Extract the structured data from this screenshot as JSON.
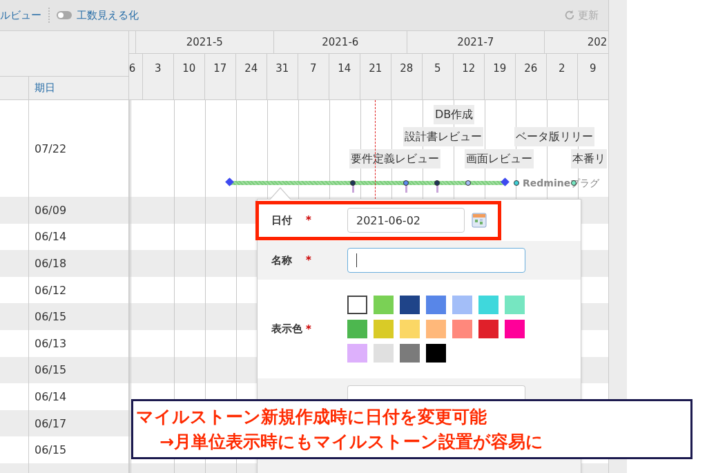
{
  "toolbar": {
    "items": [
      {
        "kind": "link",
        "label": "ルビュー"
      },
      {
        "kind": "toggle",
        "label": "工数見える化",
        "on": false
      }
    ],
    "refresh": {
      "label": "更新",
      "disabled": true
    }
  },
  "due_column": {
    "heading": "期日"
  },
  "timeline": {
    "months": [
      "2021-5",
      "2021-6",
      "2021-7",
      "202"
    ],
    "weeks": [
      "6",
      "3",
      "10",
      "17",
      "24",
      "31",
      "7",
      "14",
      "21",
      "28",
      "5",
      "12",
      "19",
      "26",
      "2",
      "9"
    ]
  },
  "rows": [
    {
      "kind": "project",
      "due": "07/22"
    },
    {
      "kind": "task",
      "due": "06/09"
    },
    {
      "kind": "task",
      "due": "06/14"
    },
    {
      "kind": "task",
      "due": "06/18"
    },
    {
      "kind": "task",
      "due": "06/12"
    },
    {
      "kind": "task",
      "due": "06/15"
    },
    {
      "kind": "task",
      "due": "06/13"
    },
    {
      "kind": "task",
      "due": "06/15"
    },
    {
      "kind": "task",
      "due": "06/14"
    },
    {
      "kind": "task",
      "due": "06/17"
    },
    {
      "kind": "task",
      "due": "06/15"
    }
  ],
  "gantt": {
    "milestones": [
      "DB作成",
      "設計書レビュー",
      "ベータ版リリー",
      "要件定義レビュー",
      "画面レビュー",
      "本番リ"
    ],
    "markers": [
      {
        "kind": "diamond",
        "color": "#3e4af0"
      },
      {
        "kind": "dot",
        "color": "#1d3557"
      },
      {
        "kind": "dot",
        "color": "#5b8dee"
      },
      {
        "kind": "dot",
        "color": "#1d3557"
      },
      {
        "kind": "dot",
        "color": "#a4bdf5"
      },
      {
        "kind": "diamond",
        "color": "#3e4af0"
      },
      {
        "kind": "dot",
        "color": "#3fd0d6"
      },
      {
        "kind": "dot",
        "color": "#76e6c1"
      }
    ],
    "project_label": "**Redmine**プラグ"
  },
  "popup": {
    "date": {
      "label": "日付",
      "required_mark": "*",
      "value": "2021-06-02",
      "highlighted": true
    },
    "name": {
      "label": "名称",
      "required_mark": "*",
      "focused": true
    },
    "color": {
      "label": "表示色",
      "required_mark": "*",
      "swatches": [
        {
          "color": "#ffffff",
          "selected": true
        },
        {
          "color": "#7ad155",
          "selected": false
        },
        {
          "color": "#1f4489",
          "selected": false
        },
        {
          "color": "#5886e8",
          "selected": false
        },
        {
          "color": "#a3bef8",
          "selected": false
        },
        {
          "color": "#3fd8dc",
          "selected": false
        },
        {
          "color": "#76e6c1",
          "selected": false
        },
        {
          "color": "#4db74f",
          "selected": false
        },
        {
          "color": "#d9cb27",
          "selected": false
        },
        {
          "color": "#fbd765",
          "selected": false
        },
        {
          "color": "#ffb87a",
          "selected": false
        },
        {
          "color": "#ff887c",
          "selected": false
        },
        {
          "color": "#e0202a",
          "selected": false
        },
        {
          "color": "#ff0099",
          "selected": false
        },
        {
          "color": "#ddb0fc",
          "selected": false
        },
        {
          "color": "#e0e0e0",
          "selected": false
        },
        {
          "color": "#7b7b7b",
          "selected": false
        },
        {
          "color": "#000000",
          "selected": false
        }
      ]
    }
  },
  "annotation": {
    "lines": [
      "マイルストーン新規作成時に日付を変更可能",
      "→月単位表示時にもマイルストーン設置が容易に"
    ]
  }
}
